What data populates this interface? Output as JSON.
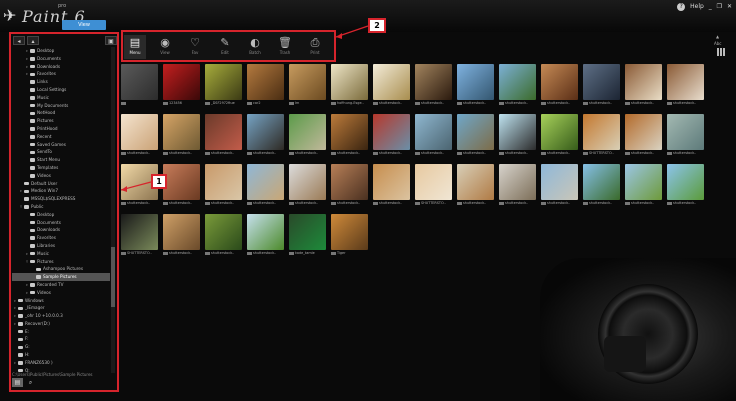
{
  "app": {
    "logo": "Paint 6",
    "version_sup": "pro",
    "view_tab": "View"
  },
  "window_controls": {
    "help": "Help",
    "minimize": "_",
    "restore": "❐",
    "close": "✕"
  },
  "callouts": {
    "sidebar": "1",
    "action_bar": "2"
  },
  "sidebar": {
    "toolbar": {
      "back": "◂",
      "up": "▴",
      "folder": "▣"
    },
    "tree": [
      {
        "label": "Desktop",
        "depth": 2,
        "tw": "▹"
      },
      {
        "label": "Documents",
        "depth": 2,
        "tw": "▹"
      },
      {
        "label": "Downloads",
        "depth": 2,
        "tw": "▹"
      },
      {
        "label": "Favorites",
        "depth": 2,
        "tw": "▹"
      },
      {
        "label": "Links",
        "depth": 2,
        "tw": ""
      },
      {
        "label": "Local Settings",
        "depth": 2,
        "tw": ""
      },
      {
        "label": "Music",
        "depth": 2,
        "tw": ""
      },
      {
        "label": "My Documents",
        "depth": 2,
        "tw": ""
      },
      {
        "label": "NetHood",
        "depth": 2,
        "tw": ""
      },
      {
        "label": "Pictures",
        "depth": 2,
        "tw": ""
      },
      {
        "label": "PrintHood",
        "depth": 2,
        "tw": ""
      },
      {
        "label": "Recent",
        "depth": 2,
        "tw": ""
      },
      {
        "label": "Saved Games",
        "depth": 2,
        "tw": ""
      },
      {
        "label": "SendTo",
        "depth": 2,
        "tw": ""
      },
      {
        "label": "Start Menu",
        "depth": 2,
        "tw": ""
      },
      {
        "label": "Templates",
        "depth": 2,
        "tw": ""
      },
      {
        "label": "Videos",
        "depth": 2,
        "tw": ""
      },
      {
        "label": "Default User",
        "depth": 1,
        "tw": ""
      },
      {
        "label": "Medion Win7",
        "depth": 1,
        "tw": "▹"
      },
      {
        "label": "MSSQL$SQLEXPRESS",
        "depth": 1,
        "tw": ""
      },
      {
        "label": "Public",
        "depth": 1,
        "tw": "▿"
      },
      {
        "label": "Desktop",
        "depth": 2,
        "tw": ""
      },
      {
        "label": "Documents",
        "depth": 2,
        "tw": ""
      },
      {
        "label": "Downloads",
        "depth": 2,
        "tw": ""
      },
      {
        "label": "Favorites",
        "depth": 2,
        "tw": ""
      },
      {
        "label": "Libraries",
        "depth": 2,
        "tw": ""
      },
      {
        "label": "Music",
        "depth": 2,
        "tw": "▹"
      },
      {
        "label": "Pictures",
        "depth": 2,
        "tw": "▿"
      },
      {
        "label": "Ashampoo Pictures",
        "depth": 3,
        "tw": ""
      },
      {
        "label": "Sample Pictures",
        "depth": 3,
        "tw": "",
        "selected": true
      },
      {
        "label": "Recorded TV",
        "depth": 2,
        "tw": "▹"
      },
      {
        "label": "Videos",
        "depth": 2,
        "tw": "▹"
      },
      {
        "label": "Windows",
        "depth": 0,
        "tw": "▹"
      },
      {
        "label": "_IEmager",
        "depth": 0,
        "tw": "▹"
      },
      {
        "label": "_ohr 10 +10.0.0.3",
        "depth": 0,
        "tw": "▹"
      },
      {
        "label": "Recover(D:)",
        "depth": 0,
        "tw": "▹"
      },
      {
        "label": "E:",
        "depth": 0,
        "tw": ""
      },
      {
        "label": "F:",
        "depth": 0,
        "tw": ""
      },
      {
        "label": "G:",
        "depth": 0,
        "tw": ""
      },
      {
        "label": "H:",
        "depth": 0,
        "tw": ""
      },
      {
        "label": "FRANZ6530 )",
        "depth": 0,
        "tw": "▹"
      },
      {
        "label": "Q:",
        "depth": 0,
        "tw": ""
      }
    ],
    "path": "C:\\Users\\Public\\Pictures\\Sample Pictures",
    "bottom": {
      "folder": "▤",
      "search": "⌕"
    }
  },
  "action_bar": {
    "items": [
      {
        "label": "Menu",
        "icon": "▤",
        "active": true
      },
      {
        "label": "View",
        "icon": "◉"
      },
      {
        "label": "Fav",
        "icon": "♡"
      },
      {
        "label": "Edit",
        "icon": "✎"
      },
      {
        "label": "Batch",
        "icon": "◐"
      },
      {
        "label": "Trash",
        "icon": "🗑"
      },
      {
        "label": "Print",
        "icon": "⎙"
      }
    ]
  },
  "right_controls": {
    "zoom_label": "▲",
    "zoom_value": "Abc"
  },
  "thumbnails": [
    {
      "caption": "",
      "c1": "#5a5a5a",
      "c2": "#2c2c2c"
    },
    {
      "caption": "123456",
      "c1": "#c41f1f",
      "c2": "#3a0808"
    },
    {
      "caption": "_DSF2972ftue",
      "c1": "#a7ad3c",
      "c2": "#3b3a14"
    },
    {
      "caption": "car2",
      "c1": "#b47a3f",
      "c2": "#4a2d12"
    },
    {
      "caption": "Im",
      "c1": "#c79b5f",
      "c2": "#6b4a20"
    },
    {
      "caption": "hoffnung-Esge..",
      "c1": "#eee6c8",
      "c2": "#7a6a3a"
    },
    {
      "caption": "shutterstock..",
      "c1": "#f3ecd9",
      "c2": "#a88d4e"
    },
    {
      "caption": "shutterstock..",
      "c1": "#a2845e",
      "c2": "#2b1a0e"
    },
    {
      "caption": "shutterstock..",
      "c1": "#7fb2e0",
      "c2": "#33566f"
    },
    {
      "caption": "shutterstock..",
      "c1": "#7cb0d6",
      "c2": "#3b6b2a"
    },
    {
      "caption": "shutterstock..",
      "c1": "#c58a55",
      "c2": "#5a2e16"
    },
    {
      "caption": "shutterstock..",
      "c1": "#5e6f86",
      "c2": "#1c2533"
    },
    {
      "caption": "shutterstock..",
      "c1": "#8a5a35",
      "c2": "#e9ddc6"
    },
    {
      "caption": "shutterstock..",
      "c1": "#8a5a35",
      "c2": "#e8ddcd"
    },
    {
      "caption": "shutterstock..",
      "c1": "#f4e4cf",
      "c2": "#caa276"
    },
    {
      "caption": "shutterstock..",
      "c1": "#d6a466",
      "c2": "#6e5a33"
    },
    {
      "caption": "shutterstock..",
      "c1": "#6b3a2a",
      "c2": "#c25c4a"
    },
    {
      "caption": "shutterstock..",
      "c1": "#76a3c4",
      "c2": "#2e2a24"
    },
    {
      "caption": "shutterstock..",
      "c1": "#5c9b4a",
      "c2": "#c0b89a"
    },
    {
      "caption": "shutterstock..",
      "c1": "#bc7b3b",
      "c2": "#3a2410"
    },
    {
      "caption": "shutterstock..",
      "c1": "#b7382c",
      "c2": "#6a8fa8"
    },
    {
      "caption": "shutterstock..",
      "c1": "#8fb7d0",
      "c2": "#4b6470"
    },
    {
      "caption": "shutterstock..",
      "c1": "#6fa7c9",
      "c2": "#7d6c48"
    },
    {
      "caption": "shutterstock..",
      "c1": "#bfe3f0",
      "c2": "#2b2b2b"
    },
    {
      "caption": "shutterstock..",
      "c1": "#a7d15a",
      "c2": "#365c1a"
    },
    {
      "caption": "SHUTTERSTO..",
      "c1": "#c4782f",
      "c2": "#d8cfb6"
    },
    {
      "caption": "shutterstock..",
      "c1": "#b36a2a",
      "c2": "#d9d2c1"
    },
    {
      "caption": "shutterstock..",
      "c1": "#a3b9b2",
      "c2": "#5d7a7a"
    },
    {
      "caption": "shutterstock..",
      "c1": "#f1d9a7",
      "c2": "#8c7450"
    },
    {
      "caption": "shutterstock..",
      "c1": "#c87c5a",
      "c2": "#6a3a22"
    },
    {
      "caption": "shutterstock..",
      "c1": "#c99a6a",
      "c2": "#d9c6a7"
    },
    {
      "caption": "shutterstock..",
      "c1": "#8fb7d6",
      "c2": "#c9a775"
    },
    {
      "caption": "shutterstock..",
      "c1": "#dcdcdc",
      "c2": "#9a7a55"
    },
    {
      "caption": "shutterstock..",
      "c1": "#b77f57",
      "c2": "#4a3020"
    },
    {
      "caption": "shutterstock..",
      "c1": "#c78e4e",
      "c2": "#dbc3a0"
    },
    {
      "caption": "SHUTTERSTO..",
      "c1": "#e7c9a0",
      "c2": "#f0e6d4"
    },
    {
      "caption": "shutterstock..",
      "c1": "#d8cfb8",
      "c2": "#b07a44"
    },
    {
      "caption": "shutterstock..",
      "c1": "#d7d3cc",
      "c2": "#7c6e58"
    },
    {
      "caption": "shutterstock..",
      "c1": "#8fb8d9",
      "c2": "#c9c6b8"
    },
    {
      "caption": "shutterstock..",
      "c1": "#86c0e8",
      "c2": "#3a6a2a"
    },
    {
      "caption": "shutterstock..",
      "c1": "#9bc6e6",
      "c2": "#6e9a3a"
    },
    {
      "caption": "shutterstock..",
      "c1": "#8cc4ec",
      "c2": "#5b9b3a"
    },
    {
      "caption": "SHUTTERSTO..",
      "c1": "#1a1a1a",
      "c2": "#7a8a5a"
    },
    {
      "caption": "shutterstock..",
      "c1": "#cfa067",
      "c2": "#6a4a2a"
    },
    {
      "caption": "shutterstock..",
      "c1": "#7a9a3a",
      "c2": "#2a4a1a"
    },
    {
      "caption": "shutterstock..",
      "c1": "#c6e0ee",
      "c2": "#4c8a2a"
    },
    {
      "caption": "kade_tamle",
      "c1": "#2a4a2a",
      "c2": "#1d8a3a"
    },
    {
      "caption": "Tiger",
      "c1": "#cf8a3a",
      "c2": "#5a3a1a"
    }
  ]
}
